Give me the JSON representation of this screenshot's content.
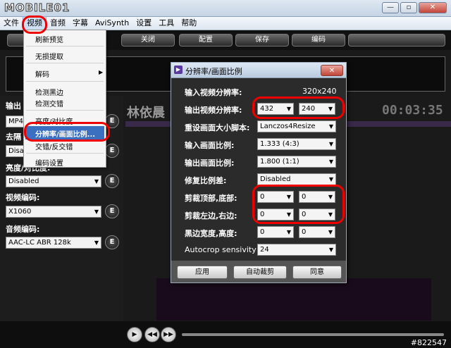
{
  "window": {
    "logo_text": "MOBILE01",
    "buttons": [
      "—",
      "▫",
      "✕"
    ]
  },
  "menubar": {
    "items": [
      "文件",
      "视频",
      "音频",
      "字幕",
      "AviSynth",
      "设置",
      "工具",
      "帮助"
    ]
  },
  "toolbar": {
    "buttons": [
      "关闭",
      "配置",
      "保存",
      "编码"
    ]
  },
  "video_menu": {
    "items": [
      "刷新预览",
      "无损提取",
      "解码",
      "检测黑边",
      "检测交错",
      "亮度/对比度",
      "分辨率/画面比例...",
      "交错/反交错",
      "编码设置"
    ]
  },
  "left": {
    "output_label": "输出",
    "output_value": "MP4",
    "deinterlace_label": "去隔",
    "deinterlace_value": "Disab",
    "brightness_label": "亮度/对比度:",
    "brightness_value": "Disabled",
    "video_codec_label": "视频编码:",
    "video_codec_value": "X1060",
    "audio_codec_label": "音频编码:",
    "audio_codec_value": "AAC-LC ABR 128k",
    "e_label": "E"
  },
  "video": {
    "title": "林依晨",
    "timecode": "00:03:35"
  },
  "dialog": {
    "title": "分辨率/画面比例",
    "close": "✕",
    "rows": {
      "input_res_label": "输入视频分辨率:",
      "input_res_value": "320x240",
      "output_res_label": "输出视频分辨率:",
      "output_res_w": "432",
      "output_res_h": "240",
      "resize_label": "重设画面大小脚本:",
      "resize_value": "Lanczos4Resize",
      "input_ratio_label": "输入画面比例:",
      "input_ratio_value": "1.333 (4:3)",
      "output_ratio_label": "输出画面比例:",
      "output_ratio_value": "1.800 (1:1)",
      "fix_ratio_label": "修复比例差:",
      "fix_ratio_value": "Disabled",
      "crop_tb_label": "剪裁顶部,底部:",
      "crop_tb_1": "0",
      "crop_tb_2": "0",
      "crop_lr_label": "剪裁左边,右边:",
      "crop_lr_1": "0",
      "crop_lr_2": "0",
      "border_label": "黑边宽度,高度:",
      "border_1": "0",
      "border_2": "0",
      "autocrop_label": "Autocrop sensivity",
      "autocrop_value": "24"
    },
    "buttons": [
      "应用",
      "自动裁剪",
      "同意"
    ]
  },
  "bottom": {
    "watermark": "#822547"
  }
}
